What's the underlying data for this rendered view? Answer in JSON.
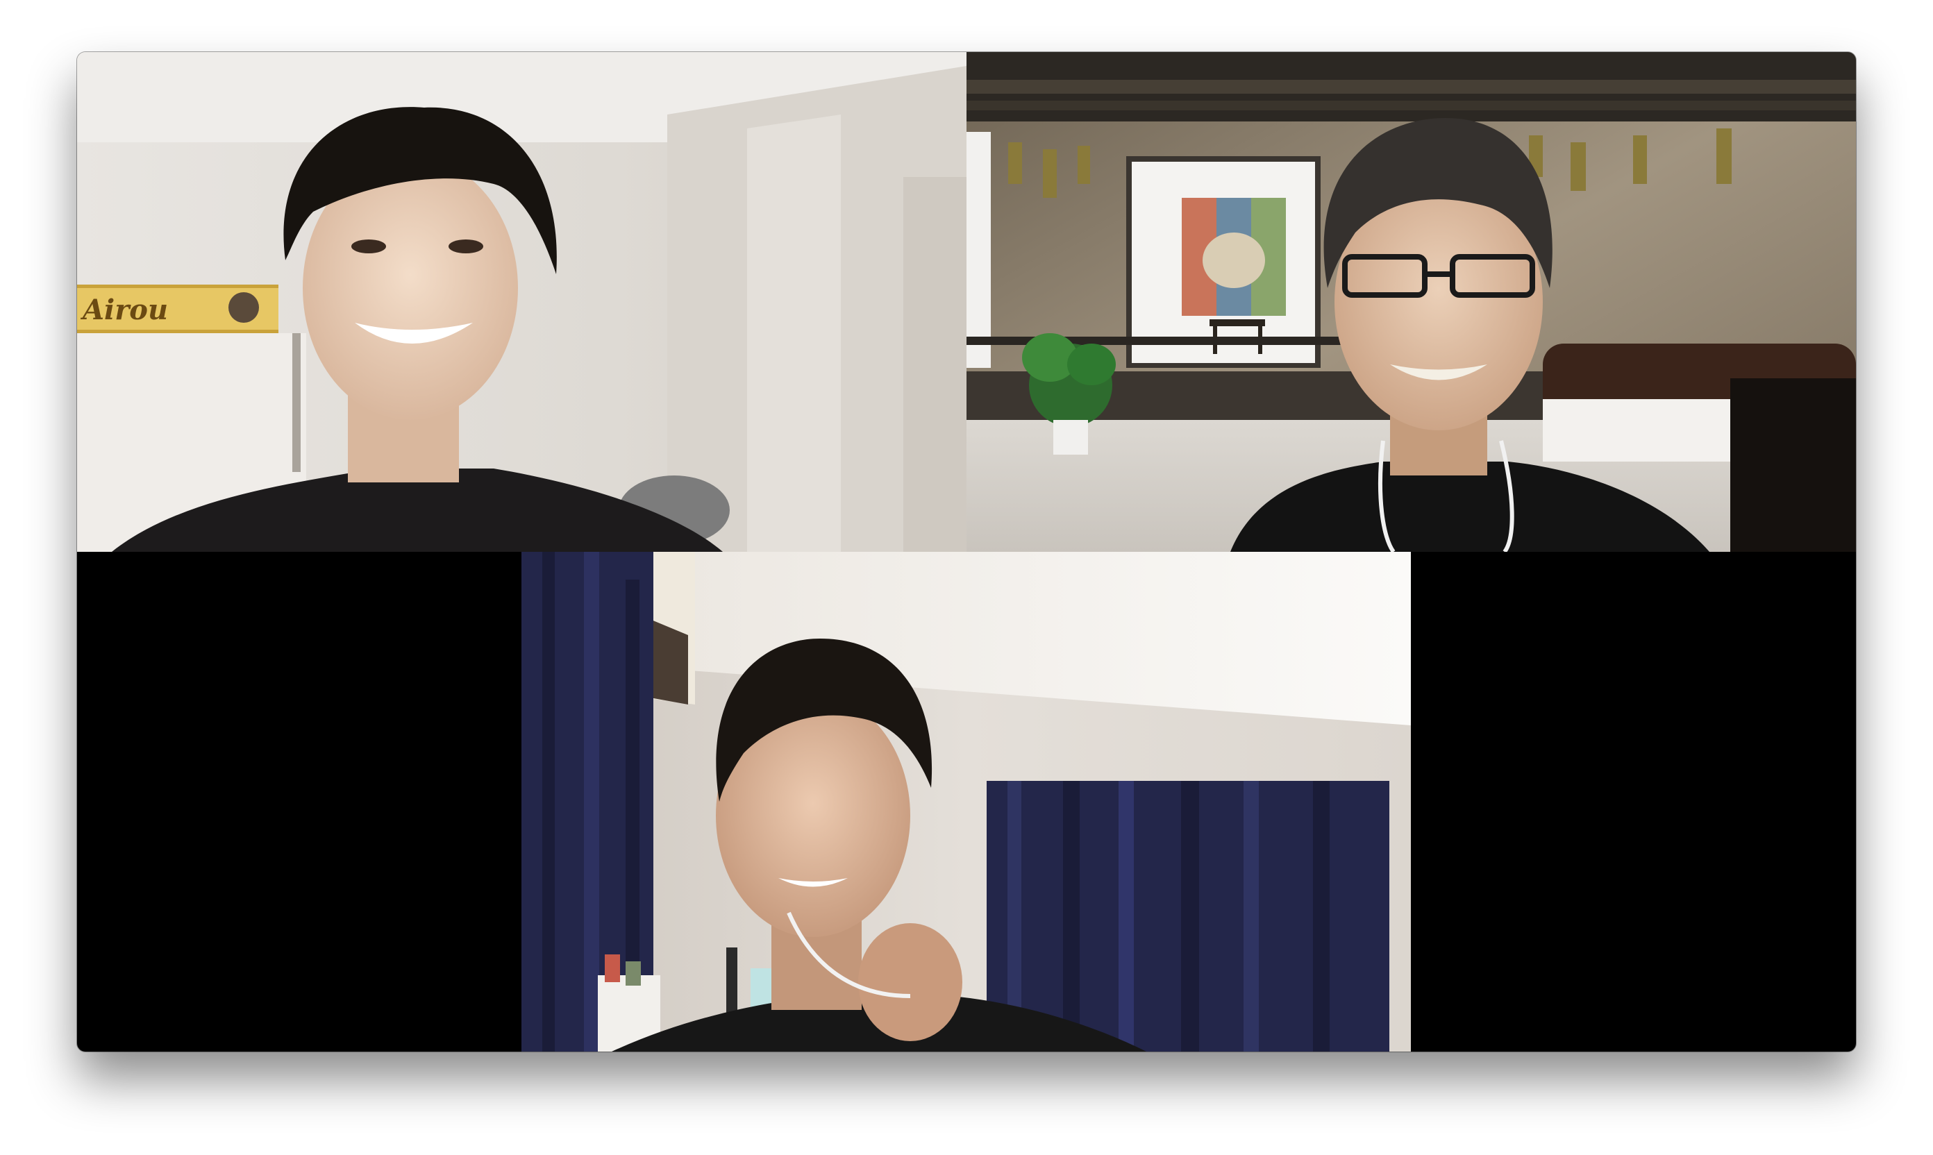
{
  "meeting": {
    "layout": "gallery-view",
    "participant_count": 3
  },
  "participants": [
    {
      "tile": "top-left",
      "background": "white-apartment-room",
      "wall_sticker_text": "Airou"
    },
    {
      "tile": "top-right",
      "background": "virtual-background-loft-studio"
    },
    {
      "tile": "bottom-center",
      "background": "bedroom-with-navy-curtains"
    }
  ],
  "colors": {
    "window_bg": "#000000",
    "room_wall": "#e6e2dc",
    "loft_wall": "#8a7f6c",
    "curtain": "#20244a"
  }
}
